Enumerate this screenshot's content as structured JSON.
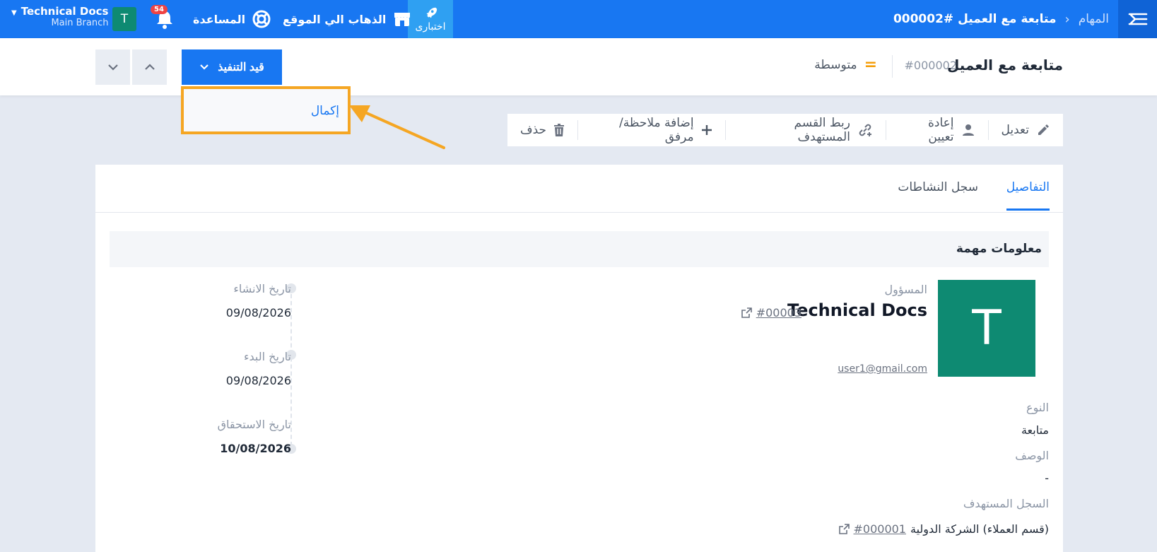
{
  "topbar": {
    "breadcrumb_parent": "المهام",
    "breadcrumb_current": "متابعة مع العميل #000002",
    "trial_label": "اختبارى",
    "goto_site_label": "الذهاب الي الموقع",
    "help_label": "المساعدة",
    "notification_count": "54",
    "avatar_letter": "T",
    "account_name": "Technical Docs",
    "account_branch": "Main Branch"
  },
  "header": {
    "title": "متابعة مع العميل",
    "code": "#000002",
    "priority_label": "متوسطة",
    "status_button_label": "قيد التنفيذ"
  },
  "dropdown": {
    "items": [
      {
        "label": "إكمال"
      }
    ]
  },
  "actions": [
    {
      "label": "تعديل",
      "icon": "pencil-icon"
    },
    {
      "label": "إعادة تعيين",
      "icon": "user-icon"
    },
    {
      "label": "ربط القسم المستهدف",
      "icon": "link-plus-icon"
    },
    {
      "label": "إضافة ملاحظة/مرفق",
      "icon": "plus-icon"
    },
    {
      "label": "حذف",
      "icon": "trash-icon"
    }
  ],
  "tabs": {
    "details": "التفاصيل",
    "activity_log": "سجل النشاطات"
  },
  "section": {
    "title": "معلومات مهمة"
  },
  "owner": {
    "label": "المسؤول",
    "avatar_letter": "T",
    "name": "Technical Docs",
    "code": "#00003",
    "email": "user1@gmail.com"
  },
  "fields": {
    "type_label": "النوع",
    "type_value": "متابعة",
    "description_label": "الوصف",
    "description_value": "-",
    "target_record_label": "السجل المستهدف",
    "target_record_text": "(قسم العملاء) الشركة الدولية",
    "target_record_code": "#000001"
  },
  "timeline": {
    "created_label": "تاريخ الانشاء",
    "created_value": "09/08/2026",
    "start_label": "تاريخ البدء",
    "start_value": "09/08/2026",
    "due_label": "تاريخ الاستحقاق",
    "due_value": "10/08/2026"
  },
  "colors": {
    "primary": "#1877f2",
    "highlight": "#f5a623",
    "avatar": "#0e8a72"
  }
}
